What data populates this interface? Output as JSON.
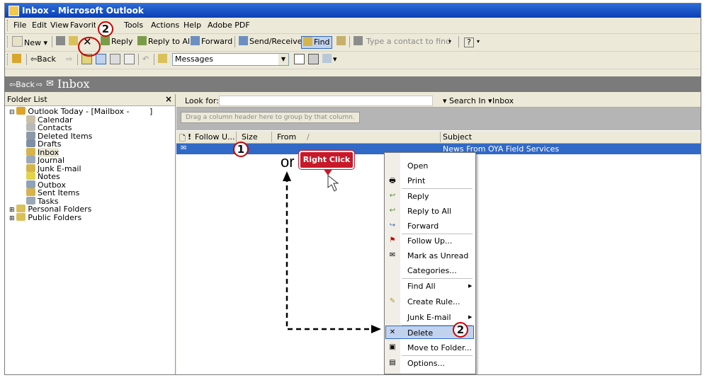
{
  "window": {
    "title": "Inbox - Microsoft Outlook"
  },
  "menu": [
    "File",
    "Edit",
    "View",
    "Favorites",
    "Tools",
    "Actions",
    "Help",
    "Adobe PDF"
  ],
  "toolbar1": {
    "new": "New",
    "reply": "Reply",
    "reply_all": "Reply to All",
    "forward": "Forward",
    "send_receive": "Send/Receive",
    "find": "Find",
    "contact_placeholder": "Type a contact to find"
  },
  "toolbar2": {
    "back": "Back",
    "view_combo": "Messages"
  },
  "navbar": {
    "back": "Back",
    "folder": "Inbox"
  },
  "folder_list": {
    "title": "Folder List",
    "close": "×",
    "items": [
      {
        "label": "Outlook Today - [Mailbox -",
        "bracket": "]",
        "icon": "outlook-today-icon",
        "color": "#d9a62b"
      },
      {
        "label": "Calendar",
        "icon": "calendar-icon",
        "color": "#c9c0a8"
      },
      {
        "label": "Contacts",
        "icon": "contacts-icon",
        "color": "#b9b9b9"
      },
      {
        "label": "Deleted Items",
        "icon": "deleted-items-icon",
        "color": "#8c9aa8"
      },
      {
        "label": "Drafts",
        "icon": "drafts-icon",
        "color": "#7d8fa6"
      },
      {
        "label": "Inbox",
        "icon": "inbox-icon",
        "color": "#d6b44c"
      },
      {
        "label": "Journal",
        "icon": "journal-icon",
        "color": "#9ba9b8"
      },
      {
        "label": "Junk E-mail",
        "icon": "junk-email-icon",
        "color": "#d6b44c"
      },
      {
        "label": "Notes",
        "icon": "notes-icon",
        "color": "#e3d34b"
      },
      {
        "label": "Outbox",
        "icon": "outbox-icon",
        "color": "#8fa2b9"
      },
      {
        "label": "Sent Items",
        "icon": "sent-items-icon",
        "color": "#d6b44c"
      },
      {
        "label": "Tasks",
        "icon": "tasks-icon",
        "color": "#9aa9b8"
      },
      {
        "label": "Personal Folders",
        "icon": "personal-folders-icon",
        "color": "#d9c05a"
      },
      {
        "label": "Public Folders",
        "icon": "public-folders-icon",
        "color": "#d9c05a"
      }
    ]
  },
  "search": {
    "look_for": "Look for:",
    "search_in": "Search In",
    "scope": "Inbox"
  },
  "group_hint": "Drag a column header here to group by that column.",
  "columns": {
    "follow": "Follow U...",
    "size": "Size",
    "from": "From",
    "subject": "Subject"
  },
  "message": {
    "subject": "News From OYA Field Services"
  },
  "context_menu": [
    "Open",
    "Print",
    "Reply",
    "Reply to All",
    "Forward",
    "Follow Up...",
    "Mark as Unread",
    "Categories...",
    "Find All",
    "Create Rule...",
    "Junk E-mail",
    "Delete",
    "Move to Folder...",
    "Options..."
  ],
  "annotations": {
    "or": "or",
    "right_click": "Right Click",
    "step1": "1",
    "step2a": "2",
    "step2b": "2"
  }
}
